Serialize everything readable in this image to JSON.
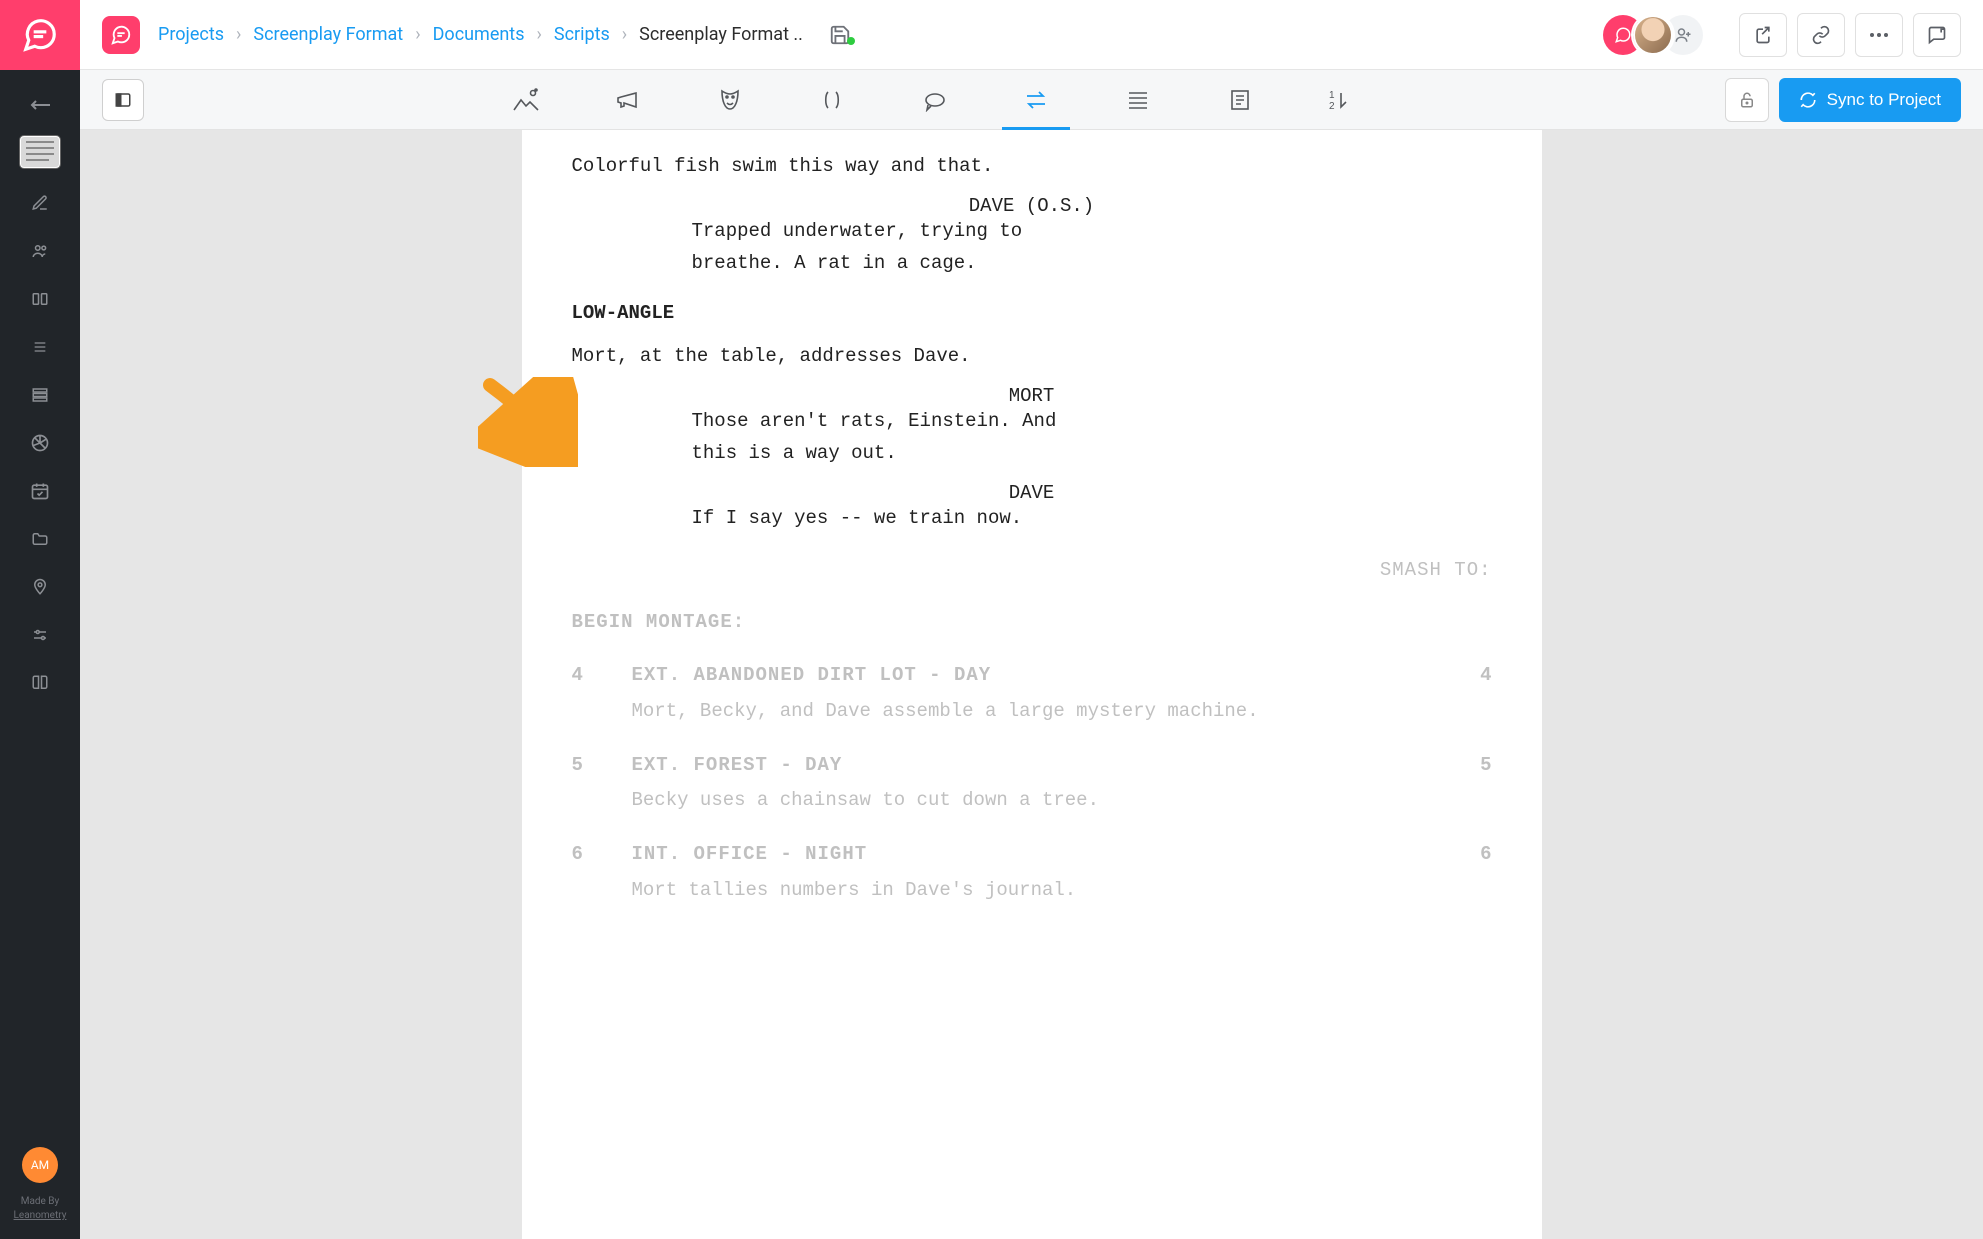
{
  "breadcrumb": {
    "links": [
      "Projects",
      "Screenplay Format",
      "Documents",
      "Scripts"
    ],
    "current": "Screenplay Format .."
  },
  "toolbar": {
    "sync_label": "Sync to Project"
  },
  "sidebar": {
    "avatar_initials": "AM",
    "footer_line1": "Made By",
    "footer_line2": "Leanometry"
  },
  "script": {
    "action0": "Colorful fish swim this way and that.",
    "char1": "DAVE (O.S.)",
    "dlg1a": "Trapped underwater, trying to",
    "dlg1b": "breathe. A rat in a cage.",
    "low_angle": "LOW-ANGLE",
    "action1": "Mort, at the table, addresses Dave.",
    "char2": "MORT",
    "dlg2a": "Those aren't rats, Einstein. And",
    "dlg2b": "this is a way out.",
    "char3": "DAVE",
    "dlg3": "If I say yes -- we train now.",
    "transition": "SMASH TO:",
    "begin_montage": "BEGIN MONTAGE:",
    "scenes": [
      {
        "n": "4",
        "slug": "EXT. ABANDONED DIRT LOT - DAY",
        "desc": "Mort, Becky, and Dave assemble a large mystery machine."
      },
      {
        "n": "5",
        "slug": "EXT. FOREST - DAY",
        "desc": "Becky uses a chainsaw to cut down a tree."
      },
      {
        "n": "6",
        "slug": "INT. OFFICE - NIGHT",
        "desc": "Mort tallies numbers in Dave's journal."
      }
    ]
  }
}
